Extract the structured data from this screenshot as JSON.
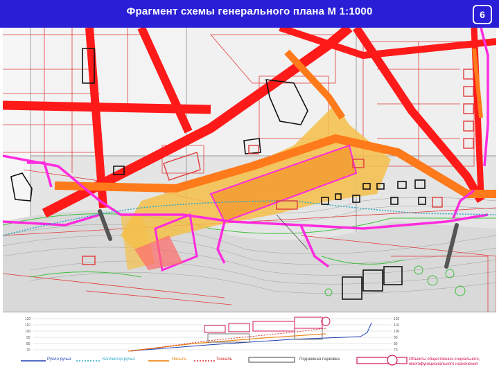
{
  "header": {
    "title": "Фрагмент схемы генерального плана М 1:1000",
    "page_number": "6",
    "background_color": "#2a1fd6"
  },
  "map": {
    "colors": {
      "primary_road": "#ff1a1a",
      "planned_road": "#ff7a1a",
      "pedestrian": "#ff2bdf",
      "embankment": "#f5b830",
      "lot_lines": "#e23a3a",
      "greenery": "#3fbf3f",
      "buildings": "#111111",
      "background": "#e9ebea"
    }
  },
  "profile": {
    "axis_left": [
      "120",
      "110",
      "100",
      "90",
      "80",
      "70"
    ],
    "axis_right": [
      "120",
      "110",
      "100",
      "90",
      "80",
      "70"
    ]
  },
  "legend": {
    "items": [
      {
        "label": "Русло ручья",
        "color": "#1f3fb0",
        "icon": "solid-line"
      },
      {
        "label": "Коллектор ручья",
        "color": "#2aa7c8",
        "icon": "dotted-line"
      },
      {
        "label": "Насыпь",
        "color": "#e8891a",
        "icon": "solid-line"
      },
      {
        "label": "Тоннель",
        "color": "#d62a2a",
        "icon": "dotted-line"
      },
      {
        "label": "Подземная парковка",
        "color": "#444444",
        "icon": "rectangle"
      },
      {
        "label": "Объекты общественно-социального, многофункционального назначения",
        "color": "#d4145a",
        "icon": "circle-rect"
      }
    ]
  }
}
